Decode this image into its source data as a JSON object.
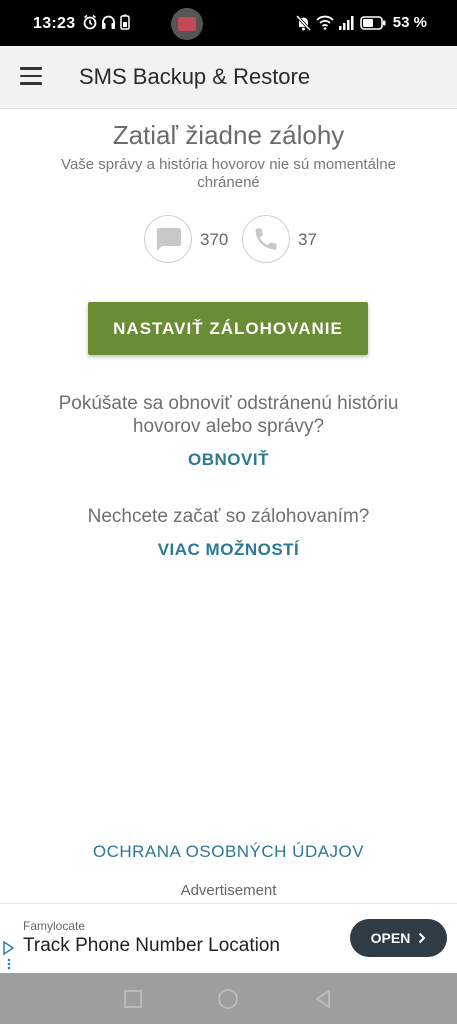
{
  "status_bar": {
    "time": "13:23",
    "battery_percent": "53 %"
  },
  "app_bar": {
    "title": "SMS Backup & Restore",
    "menu_icon": "menu-icon"
  },
  "main": {
    "headline": "Zatiaľ žiadne zálohy",
    "subline": "Vaše správy a história hovorov nie sú momentálne chránené",
    "sms_count": "370",
    "call_count": "37",
    "setup_button_label": "NASTAVIŤ ZÁLOHOVANIE",
    "restore_question": "Pokúšate sa obnoviť odstránenú históriu hovorov alebo správy?",
    "restore_link": "OBNOVIŤ",
    "no_backup_question": "Nechcete začať so zálohovaním?",
    "more_options_link": "VIAC MOŽNOSTÍ",
    "privacy_link": "OCHRANA OSOBNÝCH ÚDAJOV",
    "ad_label": "Advertisement"
  },
  "ad": {
    "advertiser": "Famylocate",
    "headline": "Track Phone Number Location",
    "cta": "OPEN"
  },
  "colors": {
    "accent_green": "#6a8c34",
    "link_blue": "#2c7896"
  }
}
